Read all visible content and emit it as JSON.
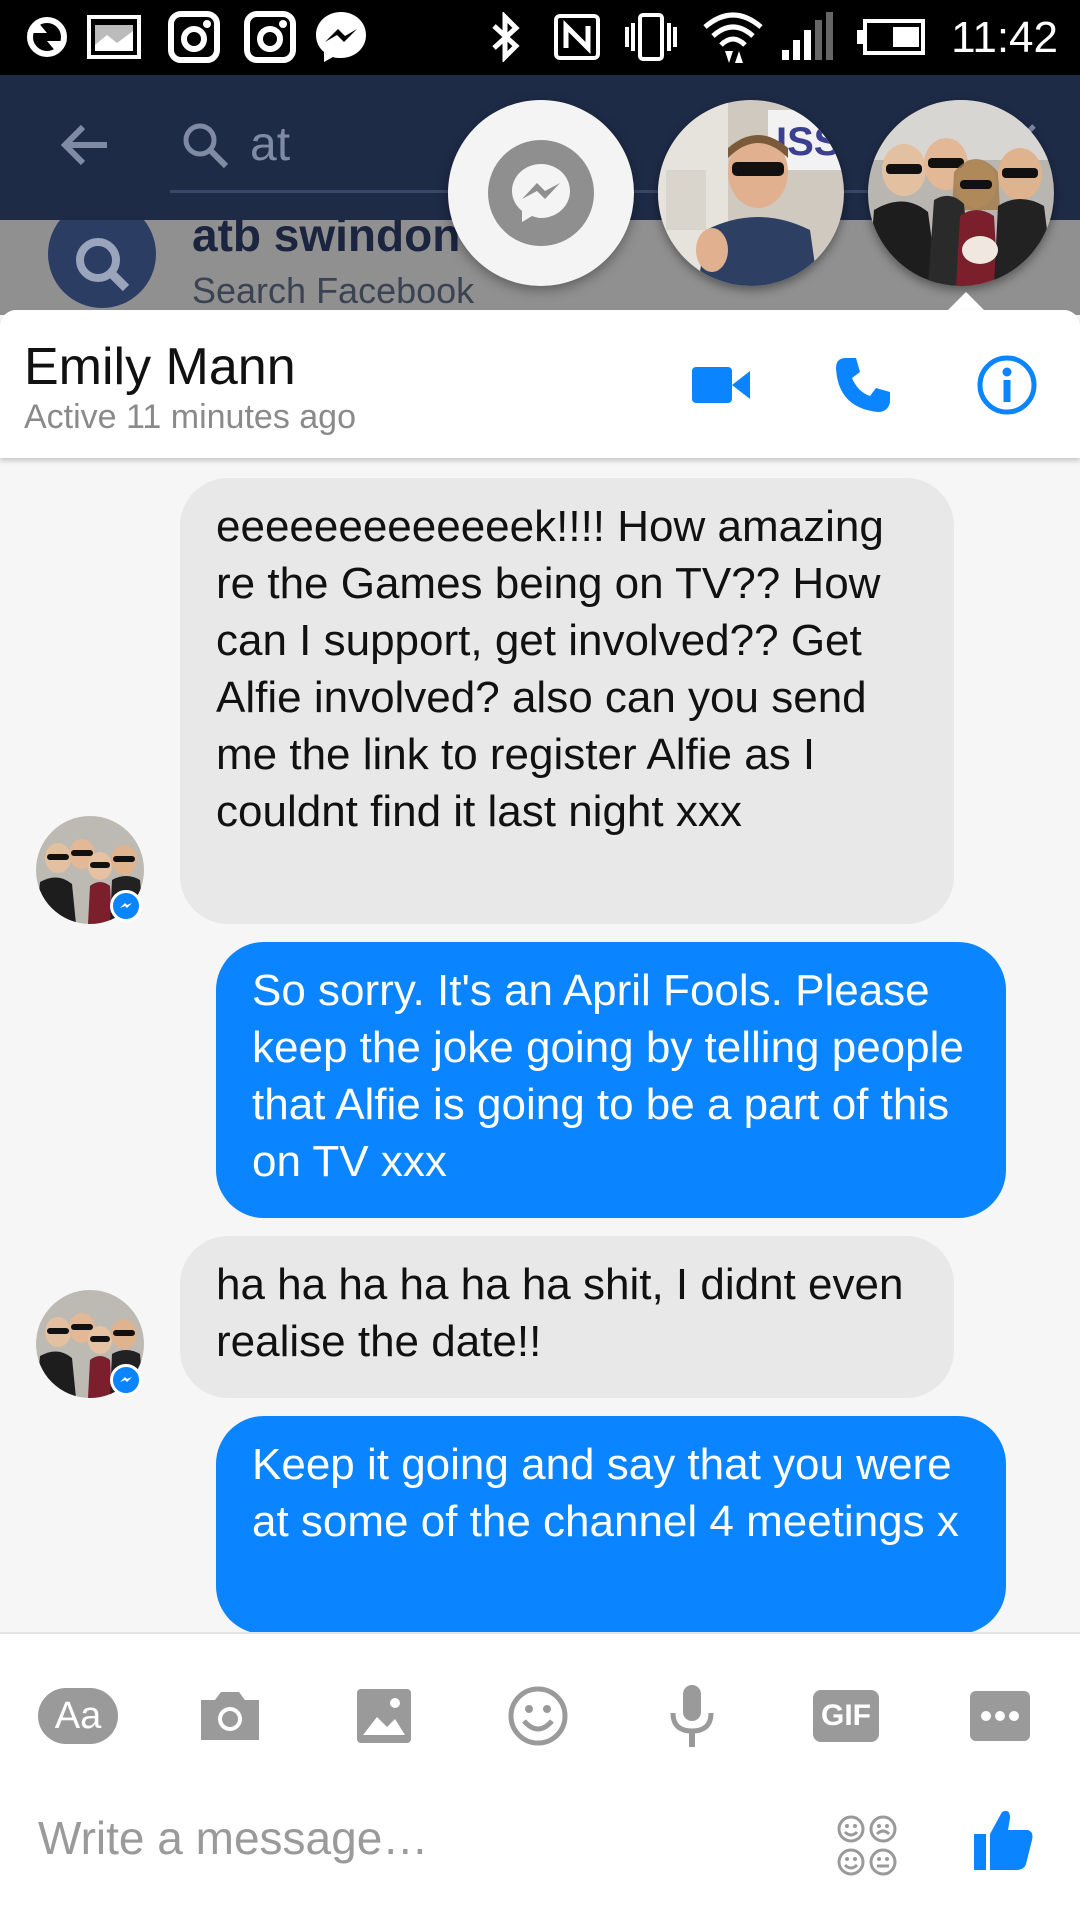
{
  "status_bar": {
    "time": "11:42",
    "icons": [
      "sync-icon",
      "image-icon",
      "instagram-icon",
      "instagram-icon",
      "messenger-icon",
      "bluetooth-icon",
      "nfc-icon",
      "vibrate-icon",
      "wifi-icon",
      "signal-icon",
      "battery-icon"
    ]
  },
  "background_app": {
    "search_query": "at",
    "suggestion_title": "atb swindon",
    "suggestion_sub": "Search Facebook"
  },
  "chat_header": {
    "name": "Emily Mann",
    "status": "Active 11 minutes ago",
    "accent": "#0b84ff"
  },
  "messages": [
    {
      "direction": "incoming",
      "text": "eeeeeeeeeeeeek!!!! How amazing re the Games being on TV?? How can I support, get involved?? Get Alfie involved? also can you send me the link to register Alfie as I couldnt find it last night xxx"
    },
    {
      "direction": "outgoing",
      "text": "So sorry. It's an April Fools. Please keep the joke going by telling people that Alfie is going to be a part of this on TV xxx"
    },
    {
      "direction": "incoming",
      "text": "ha ha ha ha ha ha shit, I didnt even realise the date!!"
    },
    {
      "direction": "outgoing",
      "text": "Keep it going and say that you were at some of the channel 4 meetings x"
    }
  ],
  "composer": {
    "aa_label": "Aa",
    "gif_label": "GIF",
    "placeholder": "Write a message…",
    "tools": [
      "text-format",
      "camera-icon",
      "gallery-icon",
      "emoji-icon",
      "microphone-icon",
      "gif-icon",
      "more-icon"
    ]
  }
}
